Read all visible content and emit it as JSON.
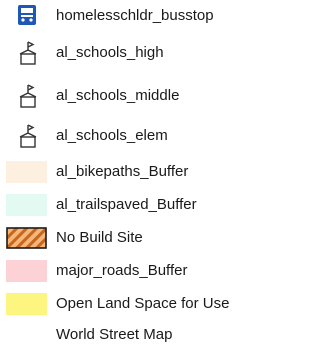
{
  "legend": {
    "items": [
      {
        "label": "homelesschldr_busstop",
        "symbol": "bus-icon",
        "color": "#1f57b5"
      },
      {
        "label": "al_schools_high",
        "symbol": "school-flag-icon",
        "color": "#333333"
      },
      {
        "label": "al_schools_middle",
        "symbol": "school-flag-icon",
        "color": "#333333"
      },
      {
        "label": "al_schools_elem",
        "symbol": "school-flag-icon",
        "color": "#333333"
      },
      {
        "label": "al_bikepaths_Buffer",
        "symbol": "fill-swatch",
        "color": "#fdf0e0"
      },
      {
        "label": "al_trailspaved_Buffer",
        "symbol": "fill-swatch",
        "color": "#e3faf3"
      },
      {
        "label": "No Build Site",
        "symbol": "hatched-swatch",
        "color": "#f0a860"
      },
      {
        "label": "major_roads_Buffer",
        "symbol": "fill-swatch",
        "color": "#fcd2d6"
      },
      {
        "label": "Open Land Space for Use",
        "symbol": "fill-swatch",
        "color": "#fcf57f"
      },
      {
        "label": "World Street Map",
        "symbol": "none",
        "color": ""
      }
    ]
  }
}
